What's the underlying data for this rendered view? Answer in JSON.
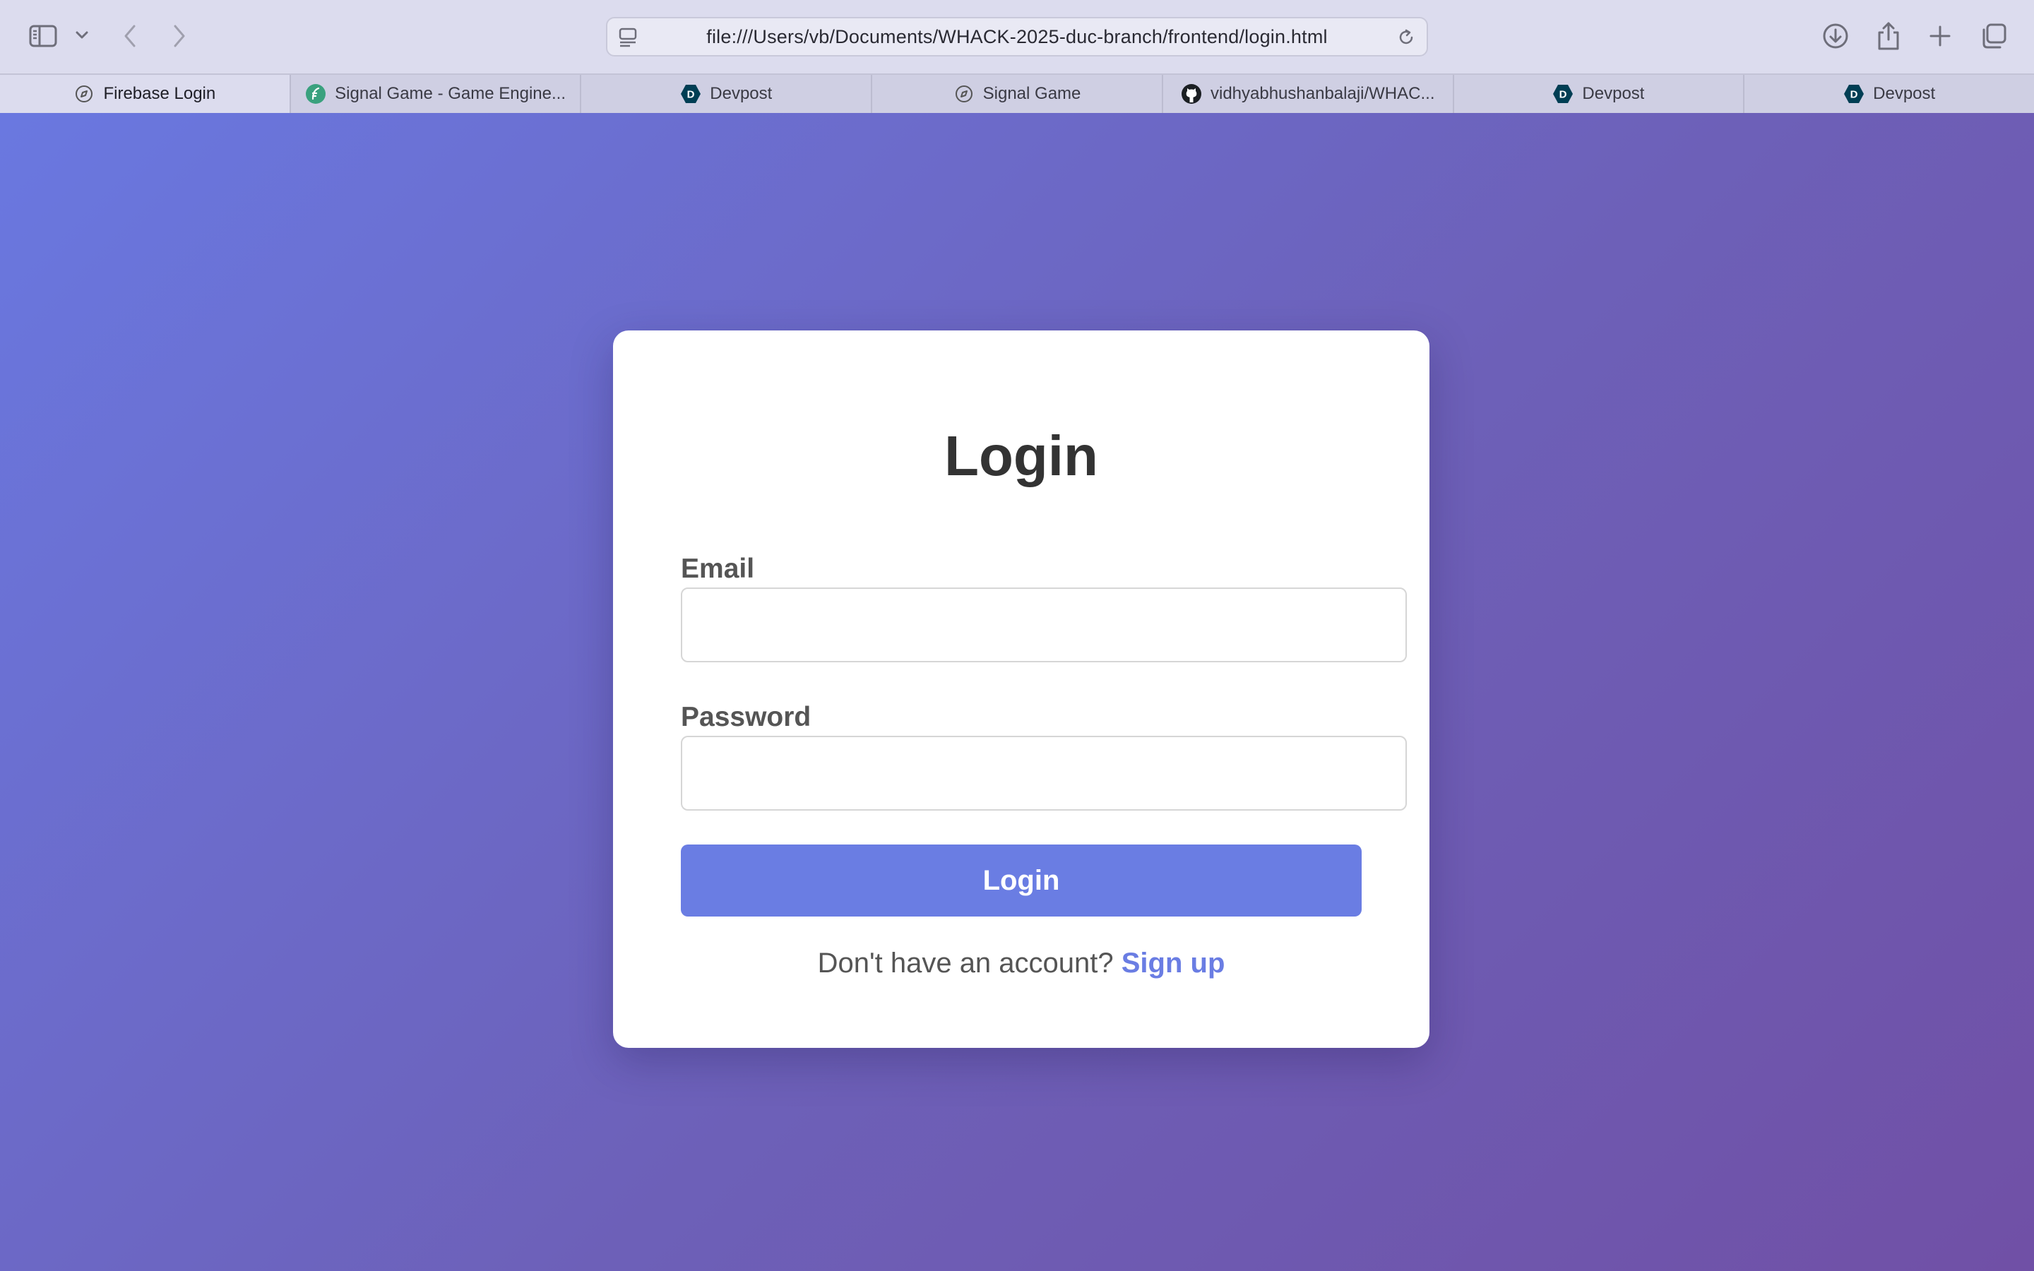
{
  "browser": {
    "url": "file:///Users/vb/Documents/WHACK-2025-duc-branch/frontend/login.html",
    "toolbar_icons": {
      "sidebar": "sidebar-icon",
      "sidebar_menu": "chevron-down-icon",
      "back": "chevron-left-icon",
      "forward": "chevron-right-icon",
      "page_menu": "page-menu-icon",
      "reload": "reload-icon",
      "downloads": "download-icon",
      "share": "share-icon",
      "new_tab": "plus-icon",
      "tab_overview": "tab-overview-icon"
    },
    "tabs": [
      {
        "label": "Firebase Login",
        "icon": "compass-icon",
        "active": true
      },
      {
        "label": "Signal Game - Game Engine...",
        "icon": "feather-icon",
        "active": false
      },
      {
        "label": "Devpost",
        "icon": "devpost-icon",
        "active": false
      },
      {
        "label": "Signal Game",
        "icon": "compass-icon",
        "active": false
      },
      {
        "label": "vidhyabhushanbalaji/WHAC...",
        "icon": "github-icon",
        "active": false
      },
      {
        "label": "Devpost",
        "icon": "devpost-icon",
        "active": false
      },
      {
        "label": "Devpost",
        "icon": "devpost-icon",
        "active": false
      }
    ]
  },
  "login": {
    "title": "Login",
    "email_label": "Email",
    "email_value": "",
    "password_label": "Password",
    "password_value": "",
    "submit_label": "Login",
    "signup_prompt": "Don't have an account?",
    "signup_link": "Sign up"
  },
  "colors": {
    "accent": "#6a7de3",
    "gradient_start": "#6a78e0",
    "gradient_end": "#7050a6"
  }
}
